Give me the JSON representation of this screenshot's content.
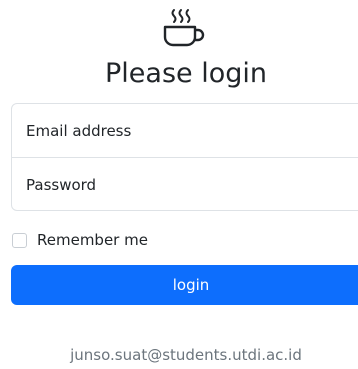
{
  "header": {
    "logo_icon": "coffee-cup-icon",
    "title": "Please login"
  },
  "form": {
    "email_placeholder": "Email address",
    "password_placeholder": "Password",
    "remember_label": "Remember me",
    "remember_checked": false,
    "submit_label": "login"
  },
  "footer": {
    "email": "junso.suat@students.utdi.ac.id"
  },
  "colors": {
    "primary": "#0d6efd",
    "border": "#dee2e6",
    "text": "#212529",
    "muted": "#6c757d"
  }
}
